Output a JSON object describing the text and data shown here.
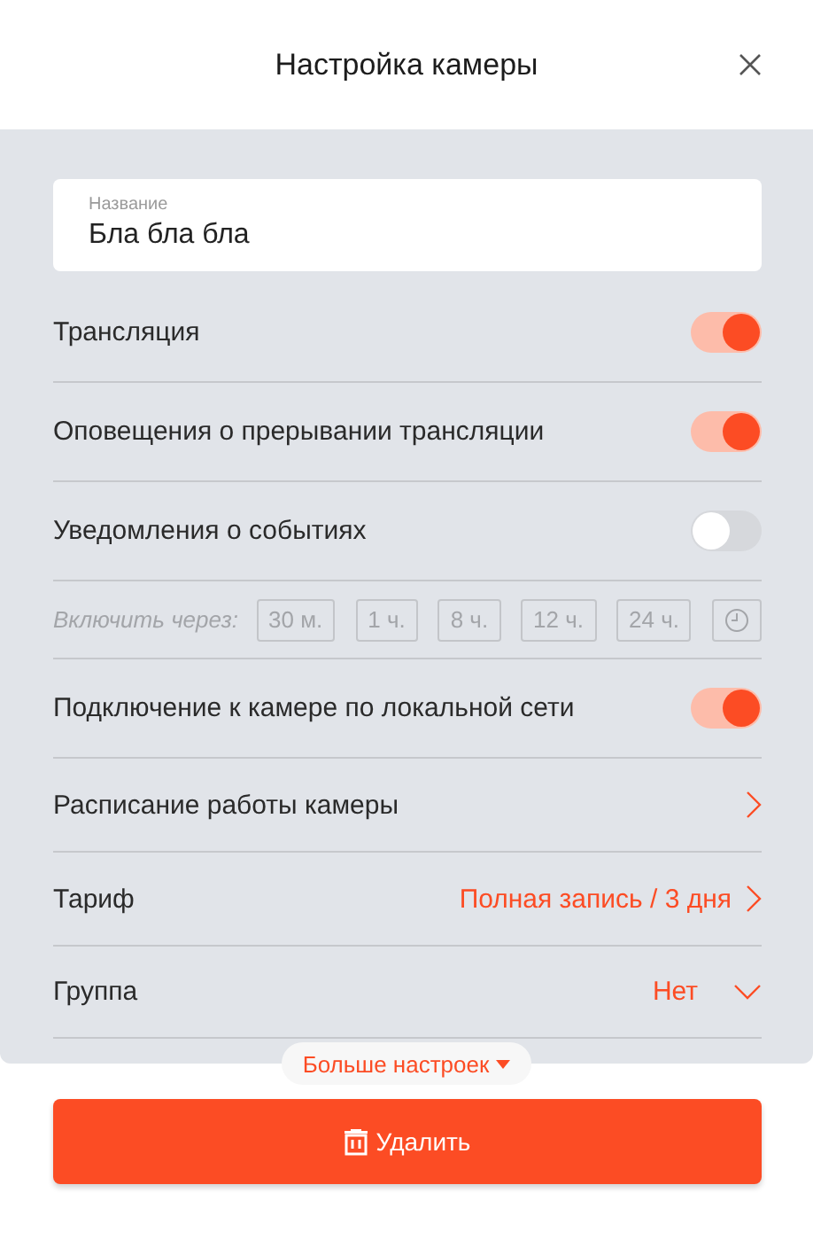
{
  "window": {
    "title": "Настройка камеры"
  },
  "name_field": {
    "label": "Название",
    "value": "Бла бла бла"
  },
  "rows": [
    {
      "kind": "toggle",
      "label": "Трансляция",
      "on": true
    },
    {
      "kind": "toggle",
      "label": "Оповещения о прерывании трансляции",
      "on": true
    },
    {
      "kind": "toggle",
      "label": "Уведомления о событиях",
      "on": false
    },
    {
      "kind": "timer",
      "label": "Включить через:",
      "disabled": true,
      "options": [
        "30 м.",
        "1 ч.",
        "8 ч.",
        "12 ч.",
        "24 ч."
      ]
    },
    {
      "kind": "toggle",
      "label": "Подключение к камере по локальной сети",
      "on": true
    },
    {
      "kind": "link",
      "label": "Расписание работы камеры"
    },
    {
      "kind": "link",
      "label": "Тариф",
      "value": "Полная запись / 3 дня"
    },
    {
      "kind": "select",
      "label": "Группа",
      "value": "Нет"
    }
  ],
  "more_button": "Больше настроек",
  "delete_button": "Удалить"
}
